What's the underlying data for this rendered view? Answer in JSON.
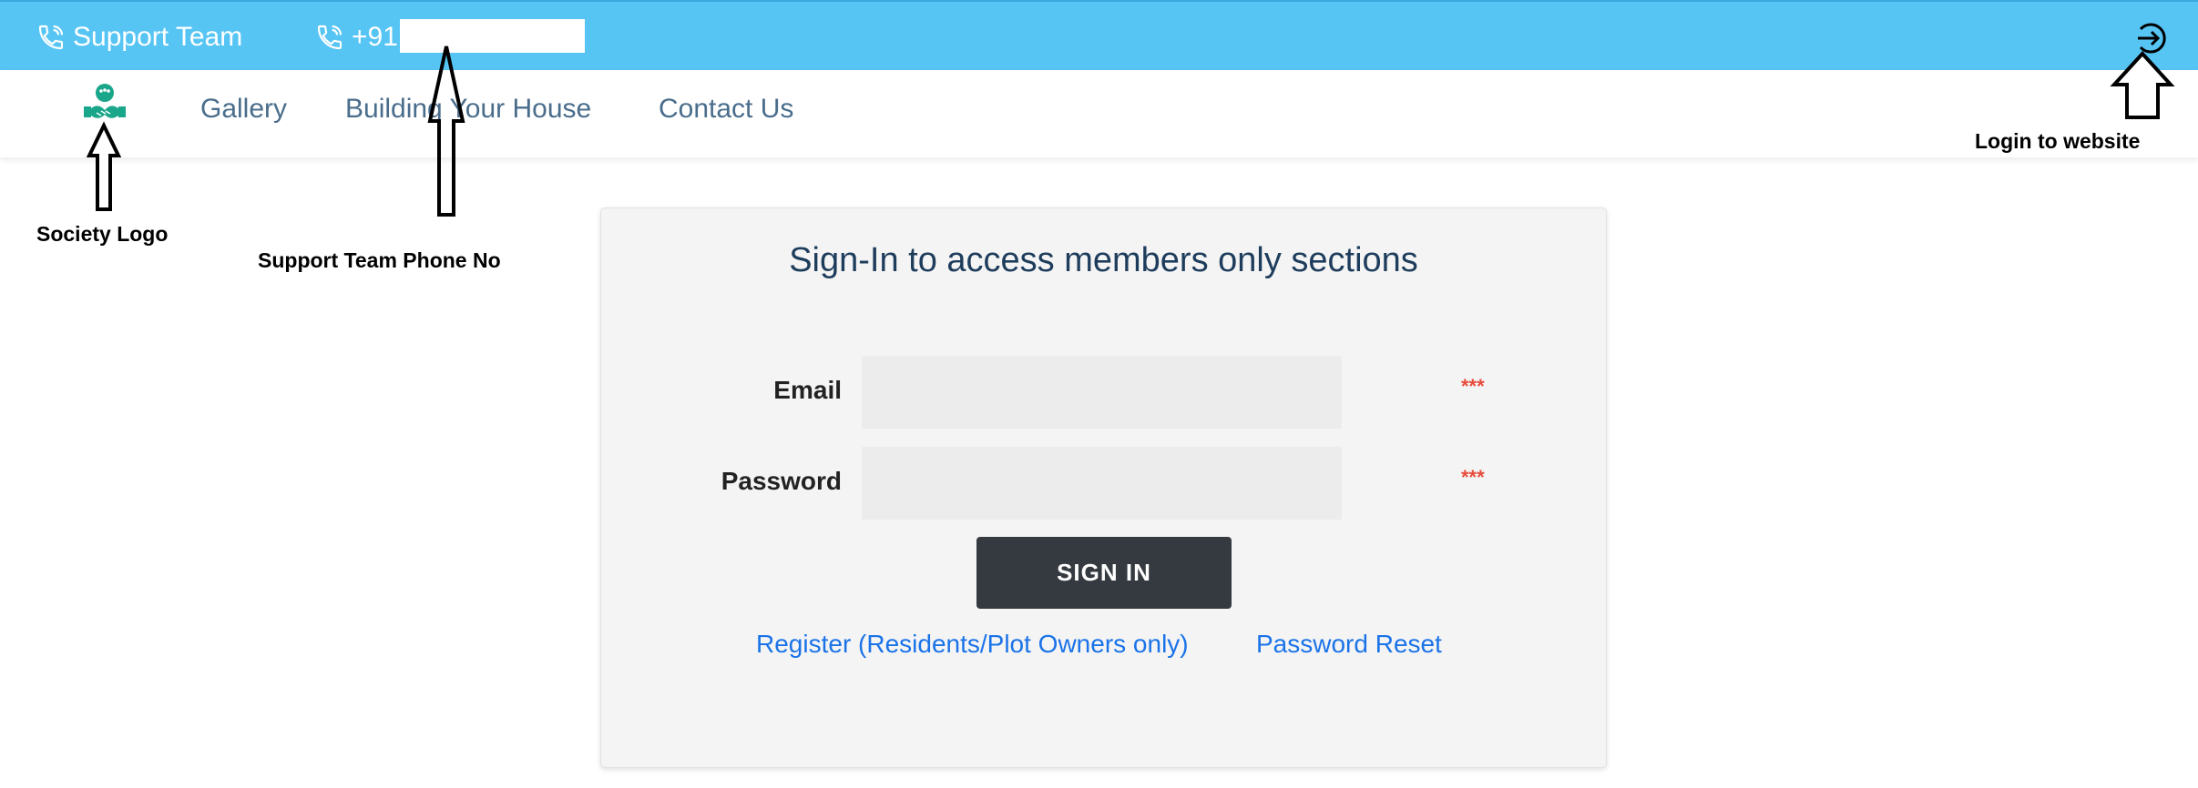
{
  "topbar": {
    "support_label": "Support Team",
    "phone_prefix": "+91",
    "icons": {
      "phone": "phone-icon",
      "login": "login-arrow-icon"
    }
  },
  "nav": {
    "logo_icon": "society-logo-icon",
    "items": [
      {
        "label": "Gallery"
      },
      {
        "label": "Building Your House"
      },
      {
        "label": "Contact Us"
      }
    ]
  },
  "annotations": {
    "society_logo": "Society Logo",
    "support_phone": "Support Team Phone No",
    "login": "Login to website"
  },
  "signin": {
    "title": "Sign-In to access members only sections",
    "email_label": "Email",
    "email_value": "",
    "password_label": "Password",
    "password_value": "",
    "required_mark": "***",
    "button_label": "SIGN IN",
    "register_link": "Register (Residents/Plot Owners only)",
    "reset_link": "Password Reset"
  },
  "colors": {
    "topbar": "#57c5f4",
    "nav_text": "#4a6d8c",
    "title": "#1e3d5c",
    "button": "#343a40",
    "link": "#1a73e8",
    "required": "#e74c3c",
    "logo": "#1aa68a"
  }
}
